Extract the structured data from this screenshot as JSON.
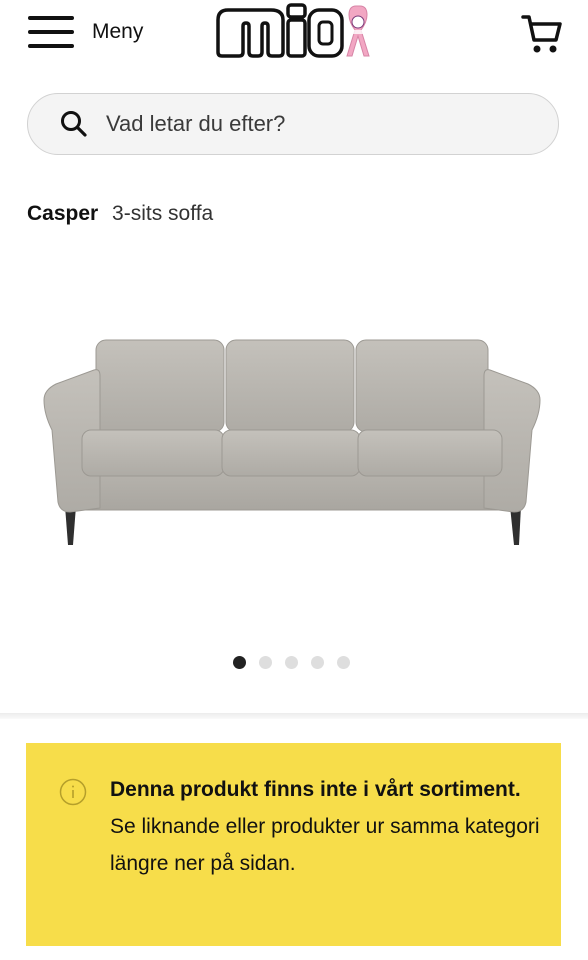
{
  "header": {
    "menu_label": "Meny",
    "logo_text": "mio",
    "icons": {
      "menu": "hamburger-icon",
      "cart": "cart-icon",
      "ribbon": "pink-ribbon-icon"
    }
  },
  "search": {
    "placeholder": "Vad letar du efter?",
    "icon": "search-icon"
  },
  "product": {
    "name": "Casper",
    "subtitle": "3-sits soffa",
    "gallery": {
      "total_images": 5,
      "active_index": 0
    }
  },
  "notice": {
    "icon": "info-icon",
    "title": "Denna produkt finns inte i vårt sortiment.",
    "body": "Se liknande eller produkter ur samma kategori längre ner på sidan.",
    "background_color": "#f7dd4a"
  },
  "colors": {
    "accent_yellow": "#f7dd4a",
    "ribbon_pink": "#f2a7c3"
  }
}
